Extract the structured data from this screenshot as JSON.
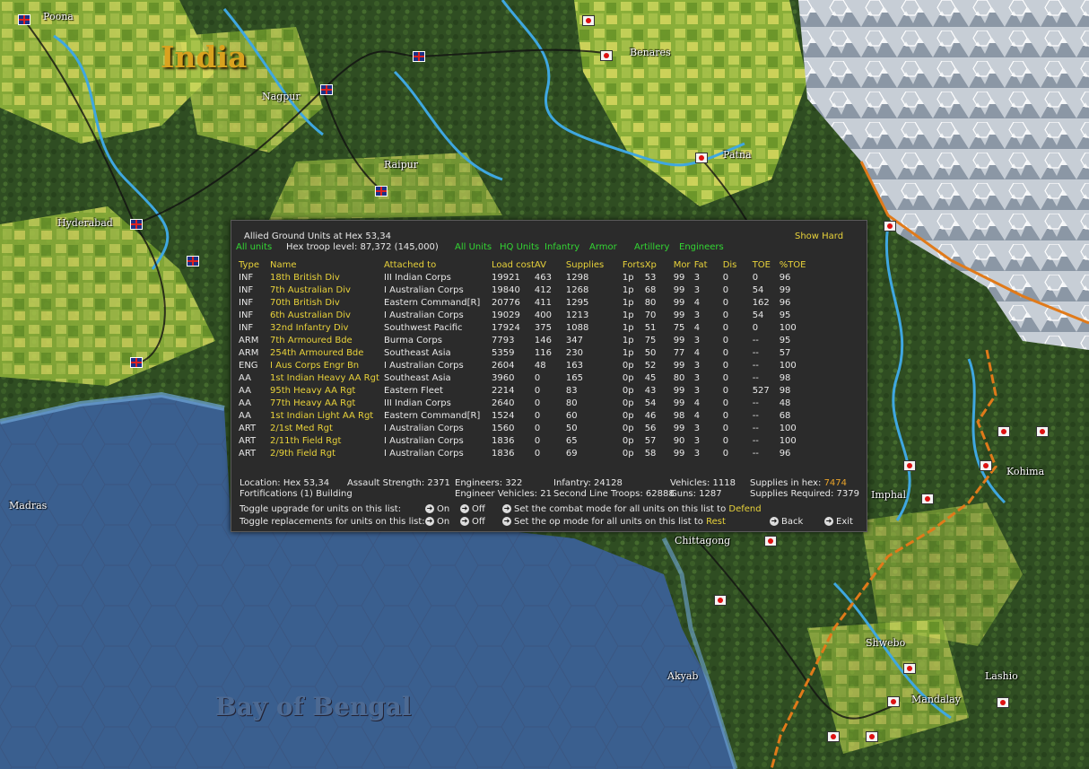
{
  "map": {
    "region_label": "India",
    "sea_label": "Bay of Bengal",
    "cities": [
      {
        "name": "Poona"
      },
      {
        "name": "Nagpur"
      },
      {
        "name": "Benares"
      },
      {
        "name": "Raipur"
      },
      {
        "name": "Patna"
      },
      {
        "name": "Hyderabad"
      },
      {
        "name": "Madras"
      },
      {
        "name": "Kohima"
      },
      {
        "name": "Imphal"
      },
      {
        "name": "Chittagong"
      },
      {
        "name": "Shwebo"
      },
      {
        "name": "Akyab"
      },
      {
        "name": "Lashio"
      },
      {
        "name": "Mandalay"
      }
    ]
  },
  "panel": {
    "title": "Allied Ground Units at Hex 53,34",
    "all_units_filter": "All units",
    "troop_level": "Hex troop level: 87,372  (145,000)",
    "show_hard": "Show Hard",
    "filters": [
      "All Units",
      "HQ Units",
      "Infantry",
      "Armor",
      "Artillery",
      "Engineers"
    ],
    "headers": {
      "type": "Type",
      "name": "Name",
      "attached": "Attached to",
      "load": "Load cost",
      "av": "AV",
      "supplies": "Supplies",
      "forts": "Forts",
      "xp": "Xp",
      "mor": "Mor",
      "fat": "Fat",
      "dis": "Dis",
      "toe": "TOE",
      "ptoe": "%TOE"
    },
    "units": [
      {
        "type": "INF",
        "name": "18th British Div",
        "attached": "III Indian Corps",
        "load": "19921",
        "av": "463",
        "supplies": "1298",
        "forts": "1p",
        "xp": "53",
        "mor": "99",
        "fat": "3",
        "dis": "0",
        "toe": "0",
        "ptoe": "96"
      },
      {
        "type": "INF",
        "name": "7th Australian Div",
        "attached": "I Australian Corps",
        "load": "19840",
        "av": "412",
        "supplies": "1268",
        "forts": "1p",
        "xp": "68",
        "mor": "99",
        "fat": "3",
        "dis": "0",
        "toe": "54",
        "ptoe": "99"
      },
      {
        "type": "INF",
        "name": "70th British Div",
        "attached": "Eastern Command[R]",
        "load": "20776",
        "av": "411",
        "supplies": "1295",
        "forts": "1p",
        "xp": "80",
        "mor": "99",
        "fat": "4",
        "dis": "0",
        "toe": "162",
        "ptoe": "96"
      },
      {
        "type": "INF",
        "name": "6th Australian Div",
        "attached": "I Australian Corps",
        "load": "19029",
        "av": "400",
        "supplies": "1213",
        "forts": "1p",
        "xp": "70",
        "mor": "99",
        "fat": "3",
        "dis": "0",
        "toe": "54",
        "ptoe": "95"
      },
      {
        "type": "INF",
        "name": "32nd Infantry Div",
        "attached": "Southwest Pacific",
        "load": "17924",
        "av": "375",
        "supplies": "1088",
        "forts": "1p",
        "xp": "51",
        "mor": "75",
        "fat": "4",
        "dis": "0",
        "toe": "0",
        "ptoe": "100"
      },
      {
        "type": "ARM",
        "name": "7th Armoured Bde",
        "attached": "Burma Corps",
        "load": "7793",
        "av": "146",
        "supplies": "347",
        "forts": "1p",
        "xp": "75",
        "mor": "99",
        "fat": "3",
        "dis": "0",
        "toe": "--",
        "ptoe": "95"
      },
      {
        "type": "ARM",
        "name": "254th Armoured Bde",
        "attached": "Southeast Asia",
        "load": "5359",
        "av": "116",
        "supplies": "230",
        "forts": "1p",
        "xp": "50",
        "mor": "77",
        "fat": "4",
        "dis": "0",
        "toe": "--",
        "ptoe": "57"
      },
      {
        "type": "ENG",
        "name": "I Aus Corps Engr Bn",
        "attached": "I Australian Corps",
        "load": "2604",
        "av": "48",
        "supplies": "163",
        "forts": "0p",
        "xp": "52",
        "mor": "99",
        "fat": "3",
        "dis": "0",
        "toe": "--",
        "ptoe": "100"
      },
      {
        "type": "AA",
        "name": "1st Indian Heavy AA Rgt",
        "attached": "Southeast Asia",
        "load": "3960",
        "av": "0",
        "supplies": "165",
        "forts": "0p",
        "xp": "45",
        "mor": "80",
        "fat": "3",
        "dis": "0",
        "toe": "--",
        "ptoe": "98"
      },
      {
        "type": "AA",
        "name": "95th Heavy AA Rgt",
        "attached": "Eastern Fleet",
        "load": "2214",
        "av": "0",
        "supplies": "83",
        "forts": "0p",
        "xp": "43",
        "mor": "99",
        "fat": "3",
        "dis": "0",
        "toe": "527",
        "ptoe": "98"
      },
      {
        "type": "AA",
        "name": "77th Heavy AA Rgt",
        "attached": "III Indian Corps",
        "load": "2640",
        "av": "0",
        "supplies": "80",
        "forts": "0p",
        "xp": "54",
        "mor": "99",
        "fat": "4",
        "dis": "0",
        "toe": "--",
        "ptoe": "48"
      },
      {
        "type": "AA",
        "name": "1st Indian Light AA Rgt",
        "attached": "Eastern Command[R]",
        "load": "1524",
        "av": "0",
        "supplies": "60",
        "forts": "0p",
        "xp": "46",
        "mor": "98",
        "fat": "4",
        "dis": "0",
        "toe": "--",
        "ptoe": "68"
      },
      {
        "type": "ART",
        "name": "2/1st Med Rgt",
        "attached": "I Australian Corps",
        "load": "1560",
        "av": "0",
        "supplies": "50",
        "forts": "0p",
        "xp": "56",
        "mor": "99",
        "fat": "3",
        "dis": "0",
        "toe": "--",
        "ptoe": "100"
      },
      {
        "type": "ART",
        "name": "2/11th Field Rgt",
        "attached": "I Australian Corps",
        "load": "1836",
        "av": "0",
        "supplies": "65",
        "forts": "0p",
        "xp": "57",
        "mor": "90",
        "fat": "3",
        "dis": "0",
        "toe": "--",
        "ptoe": "100"
      },
      {
        "type": "ART",
        "name": "2/9th Field Rgt",
        "attached": "I Australian Corps",
        "load": "1836",
        "av": "0",
        "supplies": "69",
        "forts": "0p",
        "xp": "58",
        "mor": "99",
        "fat": "3",
        "dis": "0",
        "toe": "--",
        "ptoe": "96"
      }
    ],
    "summary": {
      "location": "Location: Hex 53,34",
      "fortifications": "Fortifications (1) Building",
      "assault": "Assault Strength: 2371",
      "engineers": "Engineers:  322",
      "engineer_vehicles": "Engineer Vehicles:  21",
      "infantry": "Infantry: 24128",
      "second_line": "Second Line Troops: 62888",
      "vehicles": "Vehicles: 1118",
      "guns": "Guns: 1287",
      "supplies_in_hex_label": "Supplies in hex:",
      "supplies_in_hex_value": "7474",
      "supplies_required": "Supplies Required: 7379"
    },
    "controls": {
      "toggle_upgrade": "Toggle upgrade for units on this list:",
      "toggle_replacements": "Toggle replacements for units on this list:",
      "on": "On",
      "off": "Off",
      "combat_mode_text": "Set the combat mode for all units on this list to",
      "combat_mode_value": "Defend",
      "op_mode_text": "Set the op mode for all units on this list to",
      "op_mode_value": "Rest",
      "back": "Back",
      "exit": "Exit"
    }
  }
}
